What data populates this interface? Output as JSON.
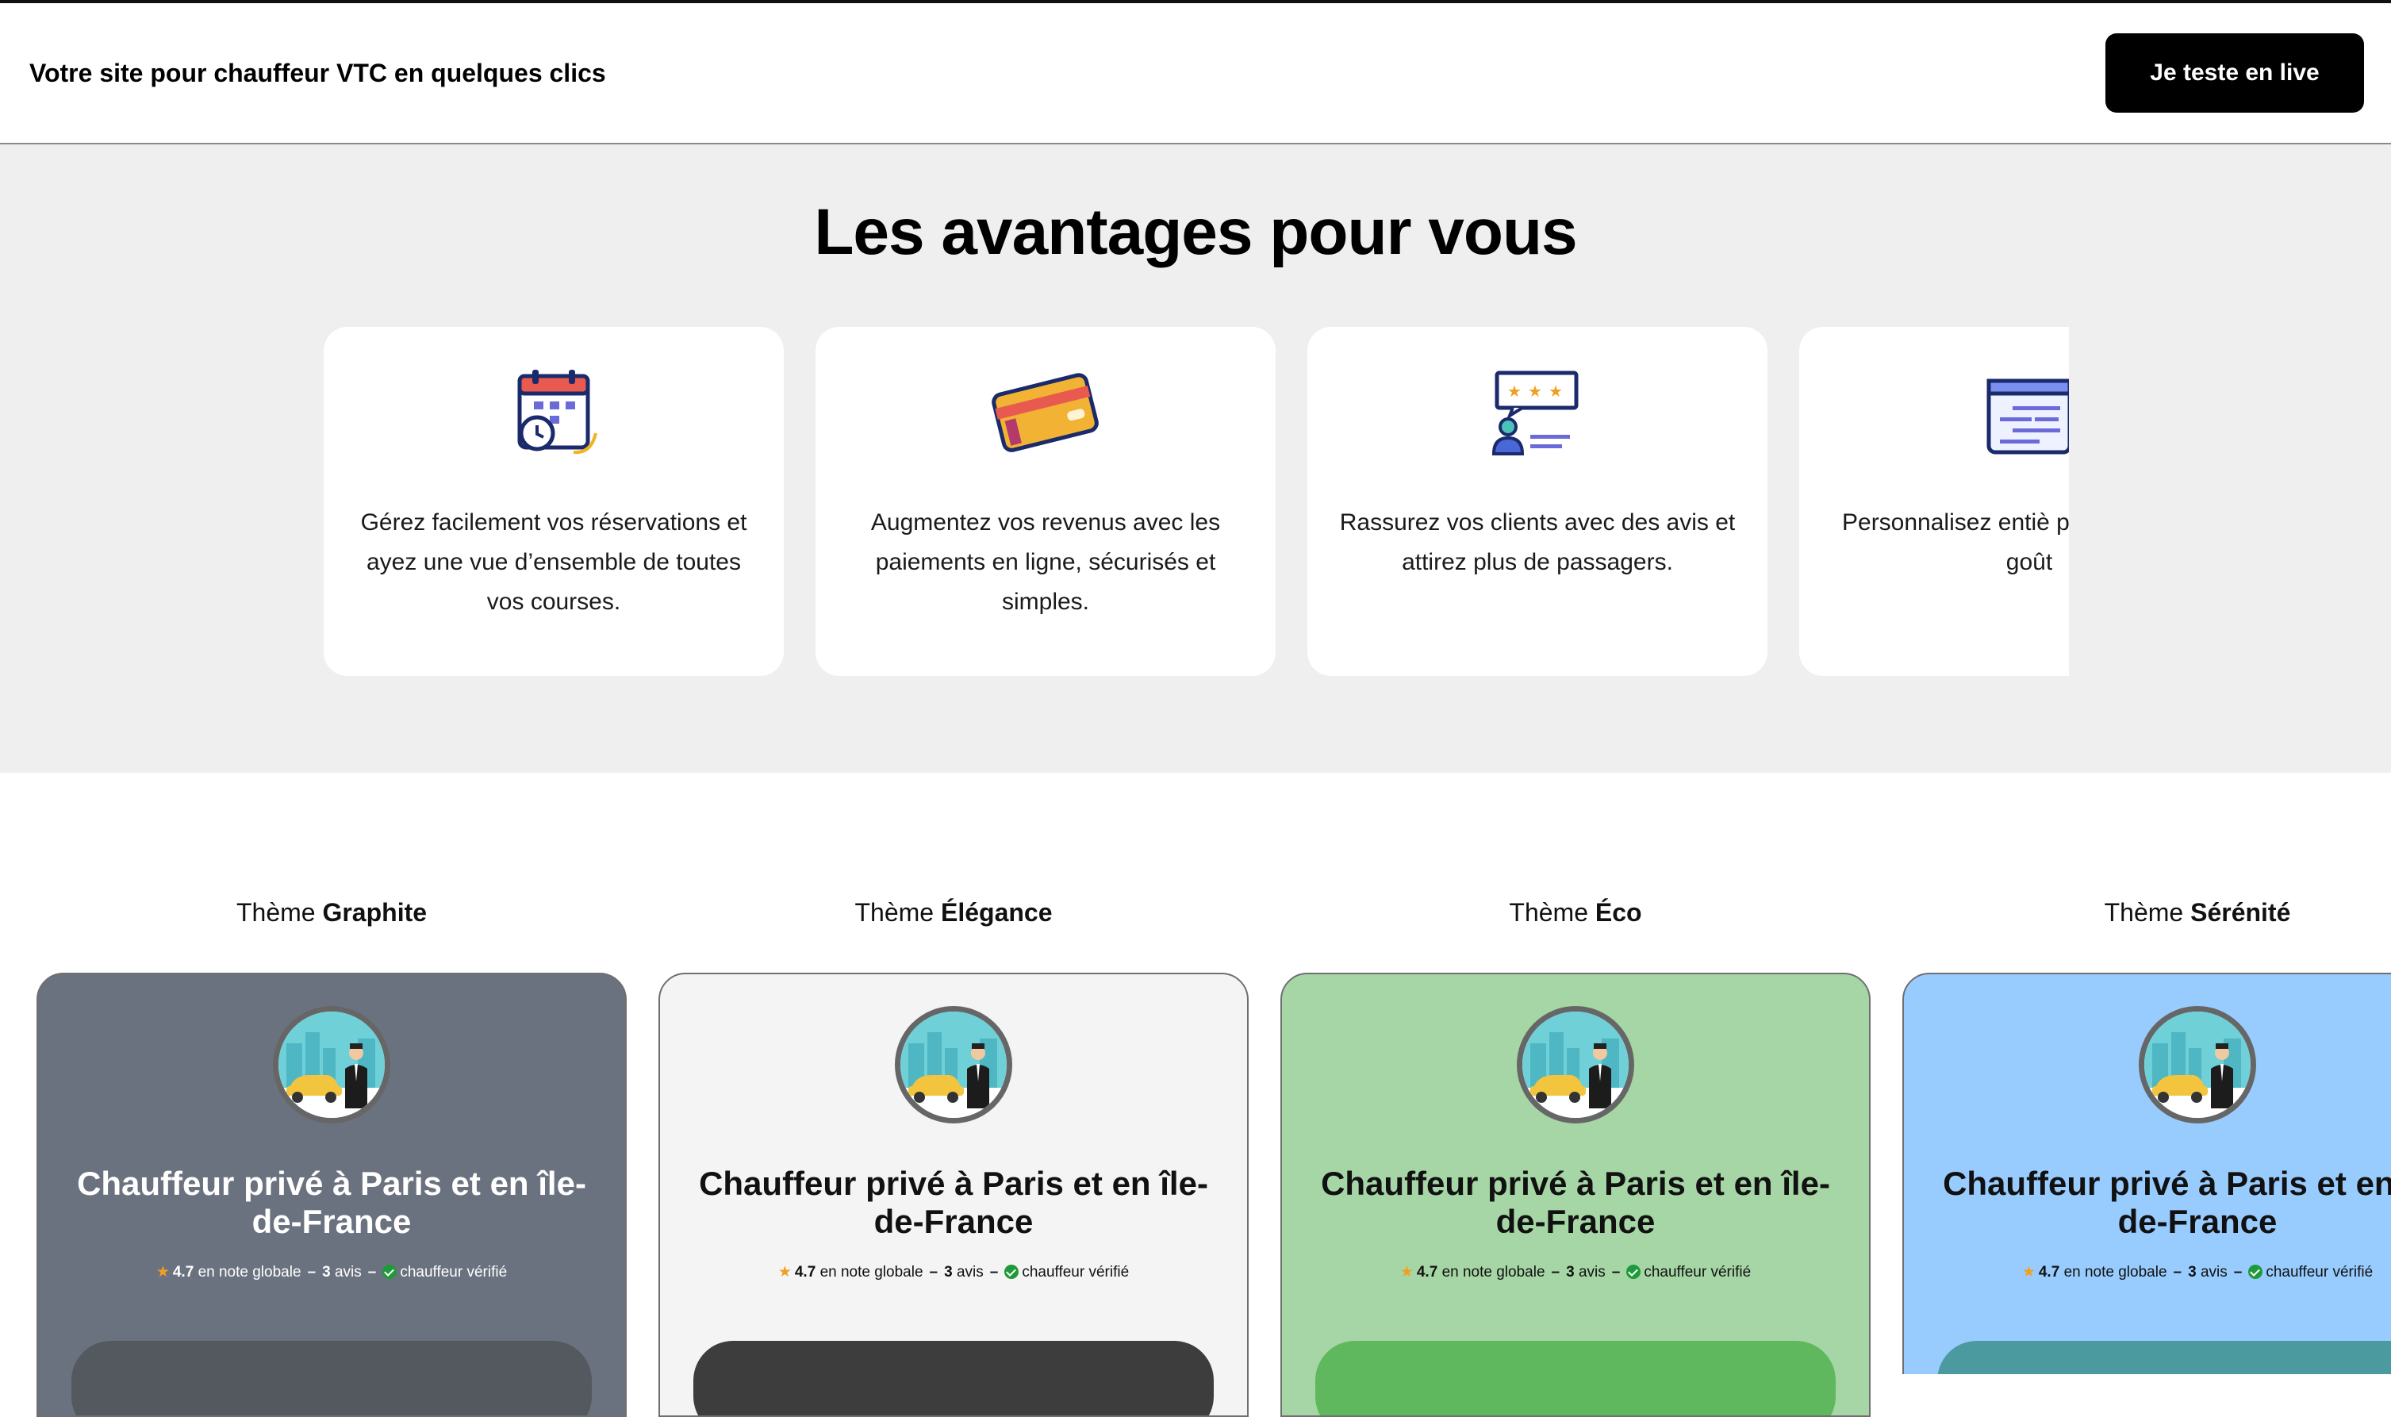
{
  "header": {
    "brand": "Votre site pour chauffeur VTC en quelques clics",
    "cta": "Je teste en live"
  },
  "advantages": {
    "title": "Les avantages pour vous",
    "cards": [
      {
        "icon": "calendar-clock-icon",
        "text": "Gérez facilement vos réservations et ayez une vue d’ensemble de toutes vos courses."
      },
      {
        "icon": "credit-card-icon",
        "text": "Augmentez vos revenus avec les paiements en ligne, sécurisés et simples."
      },
      {
        "icon": "reviews-icon",
        "text": "Rassurez vos clients avec des avis et attirez plus de passagers."
      },
      {
        "icon": "browser-page-icon",
        "text": "Personnalisez entiè page selon vos goût"
      }
    ]
  },
  "themes": {
    "prefix": "Thème",
    "items": [
      {
        "name": "Graphite",
        "bg": "#6b727f",
        "title_color": "#ffffff",
        "meta_color": "#ffffff",
        "button": "#54585f"
      },
      {
        "name": "Élégance",
        "bg": "#f4f4f4",
        "title_color": "#111111",
        "meta_color": "#111111",
        "button": "#3d3d3d"
      },
      {
        "name": "Éco",
        "bg": "#a6d6a5",
        "title_color": "#111111",
        "meta_color": "#111111",
        "button": "#5fb85e"
      },
      {
        "name": "Sérénité",
        "bg": "#99ccfe",
        "title_color": "#111111",
        "meta_color": "#111111",
        "button": "#4a9aa0"
      }
    ],
    "preview": {
      "title": "Chauffeur privé à Paris et en île-de-France",
      "rating": "4.7",
      "rating_label": "en note globale",
      "reviews": "3",
      "reviews_label": "avis",
      "verified": "chauffeur vérifié"
    }
  }
}
